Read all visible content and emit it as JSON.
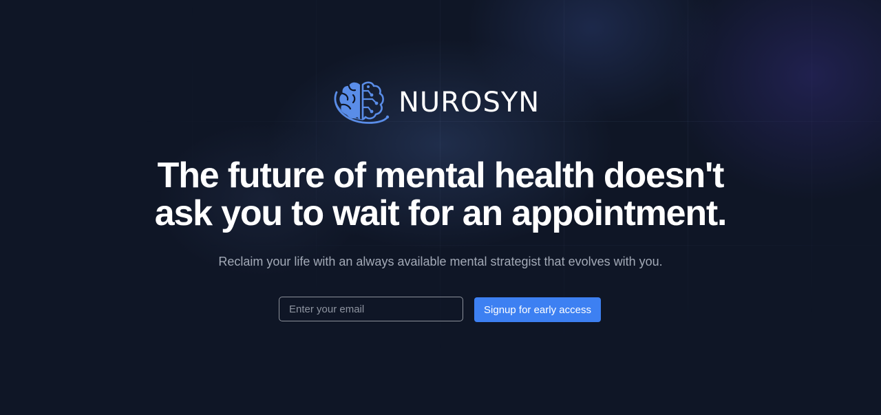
{
  "brand": {
    "name": "NUROSYN",
    "logo_icon": "brain-orbit-icon",
    "icon_color": "#5a8de8"
  },
  "hero": {
    "headline_line1": "The future of mental health doesn't",
    "headline_line2": "ask you to wait for an appointment.",
    "subtitle": "Reclaim your life with an always available mental strategist that evolves with you."
  },
  "signup": {
    "email_placeholder": "Enter your email",
    "email_value": "",
    "button_label": "Signup for early access",
    "button_color": "#3d80f2"
  },
  "theme": {
    "background": "#0f1626",
    "text": "#ffffff",
    "muted_text": "#a3aab7"
  }
}
